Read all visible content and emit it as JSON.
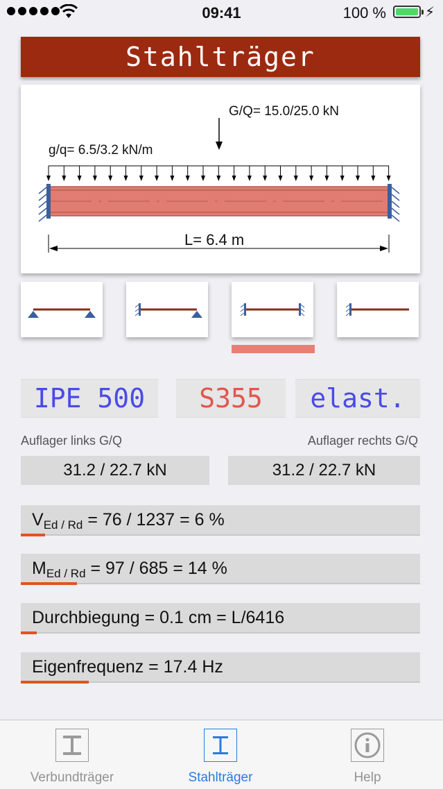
{
  "status": {
    "time": "09:41",
    "battery": "100 %"
  },
  "header": {
    "title": "Stahlträger"
  },
  "diagram": {
    "point_load": "G/Q= 15.0/25.0 kN",
    "line_load": "g/q= 6.5/3.2 kN/m",
    "span": "L= 6.4 m"
  },
  "supports": {
    "options": [
      "pinned-pinned",
      "fixed-pinned",
      "fixed-fixed",
      "fixed-free"
    ],
    "selected_index": 2
  },
  "section": {
    "profile": "IPE 500",
    "steel": "S355",
    "method": "elast."
  },
  "colors": {
    "title": "#9c2a10",
    "profile": "#4a4ae8",
    "steel": "#e0564e",
    "method": "#4a4ae8",
    "accent": "#2a7adf",
    "bar": "#e2531f"
  },
  "reactions": {
    "left_label": "Auflager links  G/Q",
    "left_value": "31.2 / 22.7 kN",
    "right_label": "Auflager rechts  G/Q",
    "right_value": "31.2 / 22.7 kN"
  },
  "results": {
    "shear": {
      "symbol": "V",
      "sub": "Ed / Rd",
      "text": " = 76 / 1237 = 6 %",
      "utilization": 0.06
    },
    "moment": {
      "symbol": "M",
      "sub": "Ed / Rd",
      "text": " = 97 / 685 = 14 %",
      "utilization": 0.14
    },
    "deflection": {
      "text": "Durchbiegung = 0.1 cm = L/6416",
      "utilization": 0.04
    },
    "frequency": {
      "text": "Eigenfrequenz = 17.4 Hz",
      "utilization": 0.17
    }
  },
  "tabs": [
    {
      "label": "Verbundträger",
      "icon": "i-beam-icon",
      "active": false
    },
    {
      "label": "Stahlträger",
      "icon": "i-beam-icon",
      "active": true
    },
    {
      "label": "Help",
      "icon": "info-icon",
      "active": false
    }
  ]
}
